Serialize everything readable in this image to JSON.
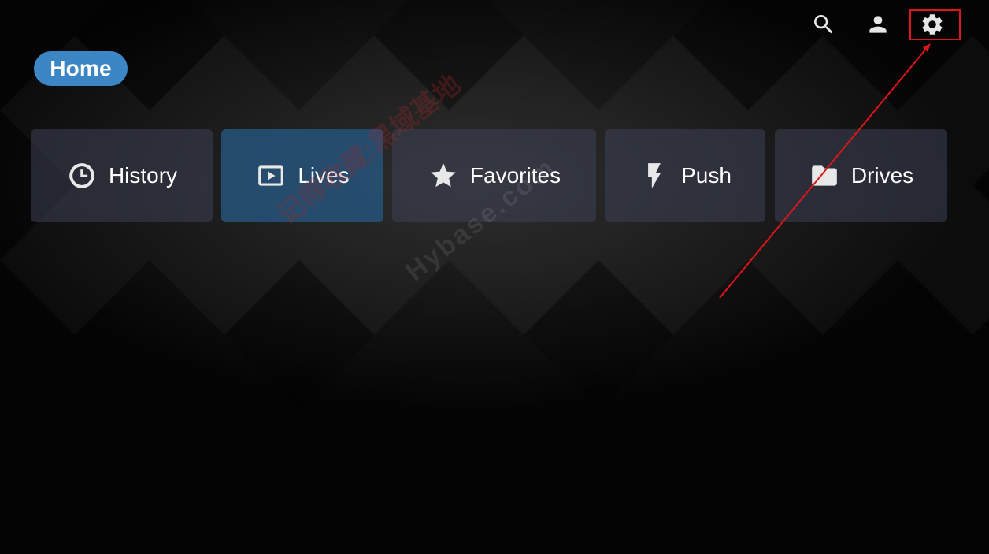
{
  "header": {
    "home_label": "Home",
    "icons": {
      "search": "search-icon",
      "user": "user-icon",
      "settings": "gear-icon"
    }
  },
  "nav_tiles": [
    {
      "label": "History",
      "icon": "clock-icon",
      "active": false
    },
    {
      "label": "Lives",
      "icon": "play-icon",
      "active": true
    },
    {
      "label": "Favorites",
      "icon": "star-icon",
      "active": false
    },
    {
      "label": "Push",
      "icon": "bolt-icon",
      "active": false
    },
    {
      "label": "Drives",
      "icon": "folder-icon",
      "active": false
    }
  ],
  "watermark": {
    "line1": "记得收藏:黑域基地",
    "line2": "Hybase.com"
  },
  "annotation": {
    "highlight_color": "#e0141b",
    "target": "settings"
  },
  "colors": {
    "accent": "#3d86c6",
    "active_tile": "#26547a",
    "tile": "#3c4254",
    "background": "#040404"
  }
}
